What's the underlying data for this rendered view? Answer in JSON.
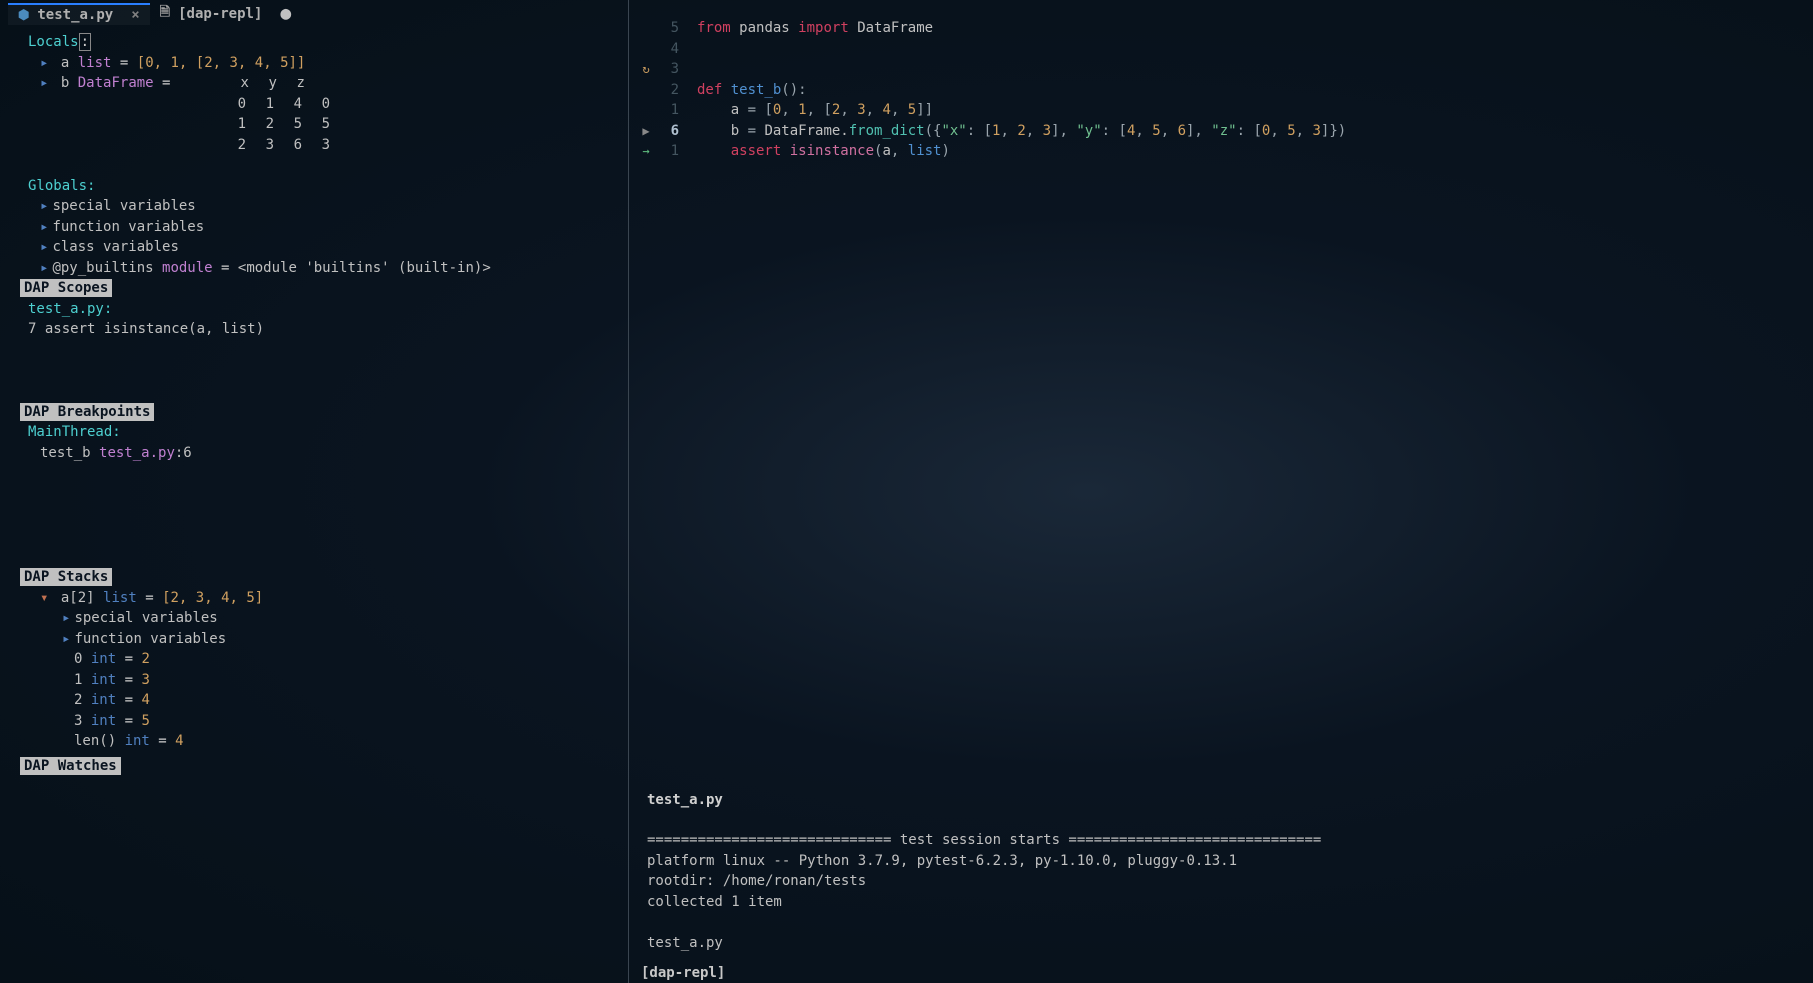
{
  "tabs": [
    {
      "name": "test_a.py",
      "icon": "python",
      "closeable": true,
      "modified": false,
      "active": true
    },
    {
      "name": "[dap-repl]",
      "icon": "file",
      "closeable": false,
      "modified": true,
      "active": false
    }
  ],
  "locals_header": "Locals",
  "locals_cursor": ":",
  "locals": {
    "a": {
      "name": "a",
      "type": "list",
      "assign_op": "=",
      "value": "[0, 1, [2, 3, 4, 5]]"
    },
    "b": {
      "name": "b",
      "type": "DataFrame",
      "assign_op": "=",
      "columns": [
        "",
        "x",
        "y",
        "z"
      ],
      "rows": [
        [
          "0",
          "1",
          "4",
          "0"
        ],
        [
          "1",
          "2",
          "5",
          "5"
        ],
        [
          "2",
          "3",
          "6",
          "3"
        ]
      ]
    }
  },
  "globals_header": "Globals:",
  "globals": [
    {
      "label": "special variables"
    },
    {
      "label": "function variables"
    },
    {
      "label": "class variables"
    },
    {
      "name": "@py_builtins",
      "type": "module",
      "assign_op": "=",
      "value": "<module 'builtins' (built-in)>"
    }
  ],
  "dap_scopes_header": "DAP  Scopes",
  "scopes_file": "test_a.py:",
  "scopes_line_num": "7",
  "scopes_line": "assert isinstance(a, list)",
  "dap_breakpoints_header": "DAP  Breakpoints",
  "bp_thread": "MainThread:",
  "bp_func": "test_b",
  "bp_file": "test_a.py",
  "bp_loc": ":6",
  "dap_stacks_header": "DAP  Stacks",
  "stack_expand": {
    "name": "a[2]",
    "type": "list",
    "assign_op": "=",
    "value": "[2, 3, 4, 5]"
  },
  "stack_children": [
    {
      "label": "special variables"
    },
    {
      "label": "function variables"
    },
    {
      "idx": "0",
      "type": "int",
      "assign_op": "=",
      "val": "2"
    },
    {
      "idx": "1",
      "type": "int",
      "assign_op": "=",
      "val": "3"
    },
    {
      "idx": "2",
      "type": "int",
      "assign_op": "=",
      "val": "4"
    },
    {
      "idx": "3",
      "type": "int",
      "assign_op": "=",
      "val": "5"
    },
    {
      "idx": "len()",
      "type": "int",
      "assign_op": "=",
      "val": "4"
    }
  ],
  "dap_watches_header": "DAP  Watches",
  "code": [
    {
      "icon": "",
      "num": "5",
      "cur": false,
      "tokens": [
        {
          "t": "from ",
          "cls": "kw"
        },
        {
          "t": "pandas ",
          "cls": "ident"
        },
        {
          "t": "import ",
          "cls": "kw"
        },
        {
          "t": "DataFrame",
          "cls": "ident"
        }
      ]
    },
    {
      "icon": "",
      "num": "4",
      "cur": false,
      "tokens": []
    },
    {
      "icon": "↻",
      "num": "3",
      "cur": false,
      "tokens": []
    },
    {
      "icon": "",
      "num": "2",
      "cur": false,
      "tokens": [
        {
          "t": "def ",
          "cls": "kw"
        },
        {
          "t": "test_b",
          "cls": "fn"
        },
        {
          "t": "():",
          "cls": "punc"
        }
      ]
    },
    {
      "icon": "",
      "num": "1",
      "cur": false,
      "tokens": [
        {
          "t": "    a ",
          "cls": "ident"
        },
        {
          "t": "= ",
          "cls": "punc"
        },
        {
          "t": "[",
          "cls": "punc"
        },
        {
          "t": "0",
          "cls": "num"
        },
        {
          "t": ", ",
          "cls": "punc"
        },
        {
          "t": "1",
          "cls": "num"
        },
        {
          "t": ", [",
          "cls": "punc"
        },
        {
          "t": "2",
          "cls": "num"
        },
        {
          "t": ", ",
          "cls": "punc"
        },
        {
          "t": "3",
          "cls": "num"
        },
        {
          "t": ", ",
          "cls": "punc"
        },
        {
          "t": "4",
          "cls": "num"
        },
        {
          "t": ", ",
          "cls": "punc"
        },
        {
          "t": "5",
          "cls": "num"
        },
        {
          "t": "]]",
          "cls": "punc"
        }
      ]
    },
    {
      "icon": "▶",
      "num": "6",
      "cur": true,
      "tokens": [
        {
          "t": "    b ",
          "cls": "ident"
        },
        {
          "t": "= ",
          "cls": "punc"
        },
        {
          "t": "DataFrame.",
          "cls": "ident"
        },
        {
          "t": "from_dict",
          "cls": "method"
        },
        {
          "t": "({",
          "cls": "punc"
        },
        {
          "t": "\"x\"",
          "cls": "str"
        },
        {
          "t": ": [",
          "cls": "punc"
        },
        {
          "t": "1",
          "cls": "num"
        },
        {
          "t": ", ",
          "cls": "punc"
        },
        {
          "t": "2",
          "cls": "num"
        },
        {
          "t": ", ",
          "cls": "punc"
        },
        {
          "t": "3",
          "cls": "num"
        },
        {
          "t": "], ",
          "cls": "punc"
        },
        {
          "t": "\"y\"",
          "cls": "str"
        },
        {
          "t": ": [",
          "cls": "punc"
        },
        {
          "t": "4",
          "cls": "num"
        },
        {
          "t": ", ",
          "cls": "punc"
        },
        {
          "t": "5",
          "cls": "num"
        },
        {
          "t": ", ",
          "cls": "punc"
        },
        {
          "t": "6",
          "cls": "num"
        },
        {
          "t": "], ",
          "cls": "punc"
        },
        {
          "t": "\"z\"",
          "cls": "str"
        },
        {
          "t": ": [",
          "cls": "punc"
        },
        {
          "t": "0",
          "cls": "num"
        },
        {
          "t": ", ",
          "cls": "punc"
        },
        {
          "t": "5",
          "cls": "num"
        },
        {
          "t": ", ",
          "cls": "punc"
        },
        {
          "t": "3",
          "cls": "num"
        },
        {
          "t": "]})",
          "cls": "punc"
        }
      ]
    },
    {
      "icon": "→",
      "num": "1",
      "cur": false,
      "tokens": [
        {
          "t": "    ",
          "cls": "ident"
        },
        {
          "t": "assert ",
          "cls": "kw"
        },
        {
          "t": "isinstance",
          "cls": "kw2"
        },
        {
          "t": "(",
          "cls": "punc"
        },
        {
          "t": "a",
          "cls": "ident"
        },
        {
          "t": ", ",
          "cls": "punc"
        },
        {
          "t": "list",
          "cls": "fn"
        },
        {
          "t": ")",
          "cls": "punc"
        }
      ]
    }
  ],
  "right_file_title": "test_a.py",
  "terminal": [
    "============================= test session starts ==============================",
    "platform linux -- Python 3.7.9, pytest-6.2.3, py-1.10.0, pluggy-0.13.1",
    "rootdir: /home/ronan/tests",
    "collected 1 item",
    "",
    "test_a.py"
  ],
  "bottom_tab": "[dap-repl]"
}
